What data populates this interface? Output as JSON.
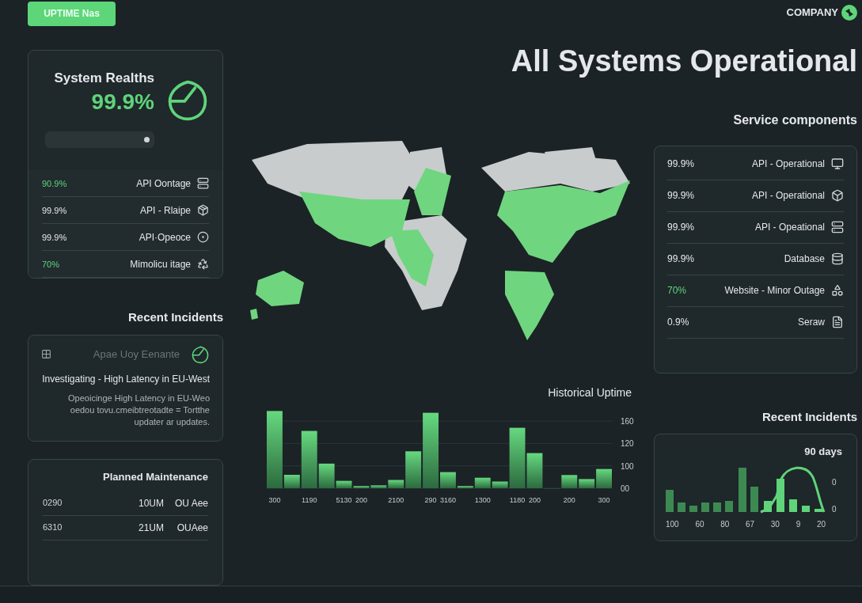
{
  "header": {
    "button": "UPTIME Nas",
    "logo": "COMPANY",
    "title": "All Systems Operational"
  },
  "system_health": {
    "title": "System Realths",
    "value": "99.9%",
    "rows": [
      {
        "name": "API Oontage",
        "value": "90.9%",
        "highlight": true
      },
      {
        "name": "API - Rlaipe",
        "value": "99.9%",
        "highlight": false
      },
      {
        "name": "API·Opeoce",
        "value": "99.9%",
        "highlight": false
      },
      {
        "name": "Mimolicu itage",
        "value": "70%",
        "highlight": true
      }
    ]
  },
  "recent_incidents": {
    "heading": "Recent Incidents",
    "source": "Apae Uoy Eenante",
    "title": "Investigating - High Latency in EU-West",
    "body": "Opeoicinge High Latency in EU-Weo oedou tovu.cmeibtreotadte = Tortthe updater ar updates."
  },
  "planned_maintenance": {
    "title": "Planned Maintenance",
    "rows": [
      {
        "column_1": "OU Aee",
        "column_2": "10UM",
        "column_3": "0290"
      },
      {
        "column_1": "OUAee",
        "column_2": "21UM",
        "column_3": "6310"
      }
    ]
  },
  "historical_uptime": {
    "title": "Historical Uptime",
    "x_labels": [
      "300",
      "1190",
      "5130",
      "200",
      "2100",
      "290",
      "3160",
      "1300",
      "1180",
      "200",
      "200",
      "300"
    ],
    "y_labels": [
      "160",
      "120",
      "100",
      "00"
    ]
  },
  "service_components": {
    "heading": "Service components",
    "rows": [
      {
        "name": "API - Operational",
        "value": "99.9%",
        "highlight": false
      },
      {
        "name": "API - Operational",
        "value": "99.9%",
        "highlight": false
      },
      {
        "name": "API - Opeational",
        "value": "99.9%",
        "highlight": false
      },
      {
        "name": "Database",
        "value": "99.9%",
        "highlight": false
      },
      {
        "name": "Website - Minor Outage",
        "value": "70%",
        "highlight": true
      },
      {
        "name": "Seraw",
        "value": "0.9%",
        "highlight": false
      }
    ]
  },
  "incident_trend": {
    "heading": "Recent Incidents",
    "period": "90 days",
    "yticks": [
      "0",
      "0"
    ],
    "xlabels": [
      "100",
      "60",
      "80",
      "67",
      "30",
      "9",
      "20"
    ]
  }
}
